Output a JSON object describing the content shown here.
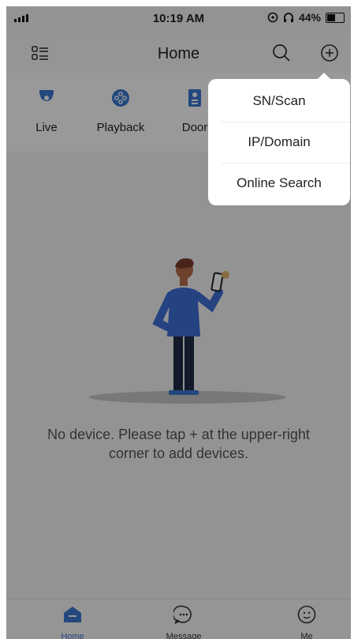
{
  "status_bar": {
    "time": "10:19 AM",
    "battery": "44%"
  },
  "header": {
    "title": "Home"
  },
  "shortcuts": [
    {
      "label": "Live",
      "icon": "camera-icon"
    },
    {
      "label": "Playback",
      "icon": "playback-icon"
    },
    {
      "label": "Door",
      "icon": "door-icon"
    }
  ],
  "empty_state": {
    "message": "No device. Please tap + at the upper-right corner to add devices."
  },
  "popup_menu": {
    "items": [
      {
        "label": "SN/Scan"
      },
      {
        "label": "IP/Domain"
      },
      {
        "label": "Online Search"
      }
    ]
  },
  "tab_bar": {
    "tabs": [
      {
        "label": "Home",
        "icon": "home-icon",
        "active": true
      },
      {
        "label": "Message",
        "icon": "message-icon",
        "active": false
      },
      {
        "label": "Me",
        "icon": "me-icon",
        "active": false
      }
    ]
  },
  "colors": {
    "accent": "#3a78d0",
    "overlay": "rgba(0,0,0,0.40)",
    "text": "#222222"
  }
}
